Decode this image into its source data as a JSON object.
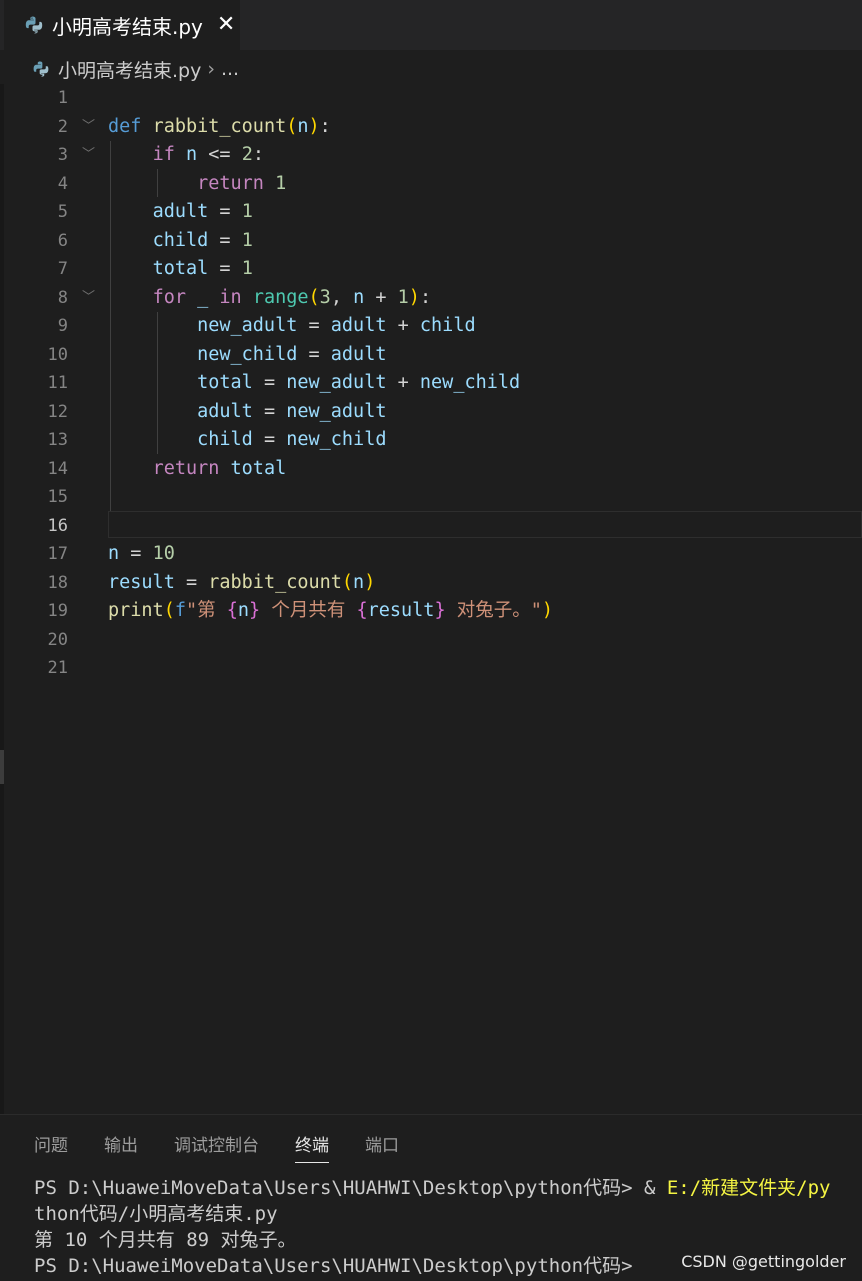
{
  "tab": {
    "filename": "小明高考结束.py",
    "close": "✕"
  },
  "breadcrumb": {
    "file": "小明高考结束.py",
    "sep": "›",
    "more": "..."
  },
  "editor": {
    "line_numbers": [
      "1",
      "2",
      "3",
      "4",
      "5",
      "6",
      "7",
      "8",
      "9",
      "10",
      "11",
      "12",
      "13",
      "14",
      "15",
      "16",
      "17",
      "18",
      "19",
      "20",
      "21"
    ],
    "active_line": 16,
    "tokens": {
      "def": "def",
      "rabbit_count": "rabbit_count",
      "lp": "(",
      "rp": ")",
      "n": "n",
      "colon": ":",
      "if": "if",
      "le": "<=",
      "two": "2",
      "return": "return",
      "one": "1",
      "adult": "adult",
      "child": "child",
      "total": "total",
      "eq": "=",
      "for": "for",
      "underscore": "_",
      "in": "in",
      "range": "range",
      "three": "3",
      "comma": ",",
      "plus": "+",
      "new_adult": "new_adult",
      "new_child": "new_child",
      "ten": "10",
      "result": "result",
      "print": "print",
      "fprefix": "f",
      "str1": "\"第 ",
      "lb": "{",
      "rb": "}",
      "str2": " 个月共有 ",
      "str3": " 对兔子。\""
    }
  },
  "panel": {
    "tabs": [
      "问题",
      "输出",
      "调试控制台",
      "终端",
      "端口"
    ],
    "active_tab": "终端",
    "terminal": {
      "line1_prompt": "PS D:\\HuaweiMoveData\\Users\\HUAHWI\\Desktop\\python代码> ",
      "line1_amp": "& ",
      "line1_cmd": "E:/新建文件夹/py",
      "line2": "thon代码/小明高考结束.py",
      "line3": "第 10 个月共有 89 对兔子。",
      "line4": "PS D:\\HuaweiMoveData\\Users\\HUAHWI\\Desktop\\python代码>"
    }
  },
  "watermark": "CSDN @gettingolder"
}
